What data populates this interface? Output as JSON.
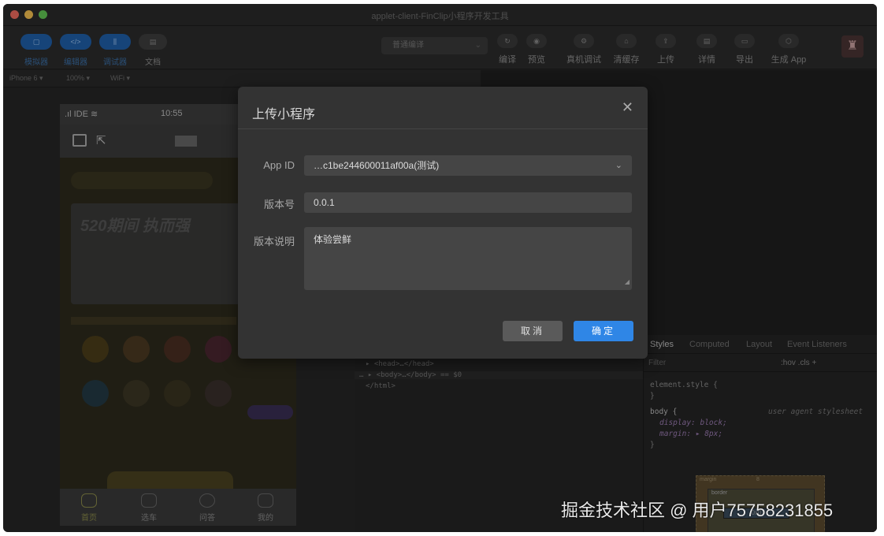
{
  "window": {
    "title": "applet-client-FinClip小程序开发工具"
  },
  "toolbar": {
    "left_buttons": [
      {
        "icon": "phone-icon",
        "label": "模拟器"
      },
      {
        "icon": "code-icon",
        "label": "编辑器"
      },
      {
        "icon": "debug-icon",
        "label": "调试器"
      },
      {
        "icon": "doc-icon",
        "label": "文档"
      }
    ],
    "compile_mode": "普通编译",
    "actions": [
      {
        "icon": "refresh-icon",
        "label": "编译"
      },
      {
        "icon": "eye-icon",
        "label": "预览"
      },
      {
        "icon": "device-debug-icon",
        "label": "真机调试"
      },
      {
        "icon": "clear-cache-icon",
        "label": "清缓存"
      },
      {
        "icon": "upload-icon",
        "label": "上传"
      },
      {
        "icon": "details-icon",
        "label": "详情"
      },
      {
        "icon": "export-icon",
        "label": "导出"
      },
      {
        "icon": "box-icon",
        "label": "生成 App"
      }
    ]
  },
  "subbar": {
    "device": "iPhone 6 ▾",
    "zoom": "100% ▾",
    "network": "WiFi ▾"
  },
  "simulator": {
    "carrier": "IDE",
    "time": "10:55",
    "banner_text": "520期间 执而强",
    "tabs": [
      {
        "icon": "home-icon",
        "label": "首页"
      },
      {
        "icon": "car-icon",
        "label": "选车"
      },
      {
        "icon": "question-icon",
        "label": "问答"
      },
      {
        "icon": "profile-icon",
        "label": "我的"
      }
    ]
  },
  "elements_panel": {
    "lines": [
      "▸ <head>…</head>",
      "… ▸ <body>…</body> == $0",
      "</html>"
    ]
  },
  "styles_panel": {
    "tabs": [
      "Styles",
      "Computed",
      "Layout",
      "Event Listeners"
    ],
    "filter_placeholder": "Filter",
    "filter_tools": ":hov  .cls  +",
    "rule1": "element.style {",
    "rule1_end": "}",
    "rule2_selector": "body {",
    "rule2_origin": "user agent stylesheet",
    "rule2_props": [
      "display: block;",
      "margin: ▸ 8px;"
    ],
    "rule2_end": "}",
    "box_model": {
      "margin_label": "margin",
      "margin_val": "8",
      "border_label": "border",
      "content": "0x0"
    }
  },
  "modal": {
    "title": "上传小程序",
    "fields": {
      "app_id_label": "App ID",
      "app_id_value": "…c1be244600011af00a(测试)",
      "version_label": "版本号",
      "version_value": "0.0.1",
      "desc_label": "版本说明",
      "desc_value": "体验尝鲜"
    },
    "cancel_label": "取消",
    "confirm_label": "确定"
  },
  "watermark": "掘金技术社区 @ 用户75758231855",
  "colors": {
    "accent": "#2f86e6",
    "modal_bg": "#333333",
    "window_bg": "#262626"
  }
}
